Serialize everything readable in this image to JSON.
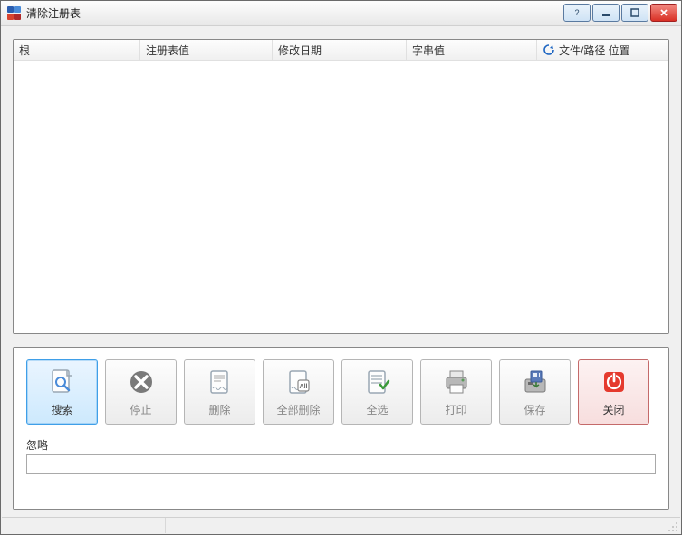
{
  "window": {
    "title": "清除注册表"
  },
  "columns": {
    "root": "根",
    "regvalue": "注册表值",
    "moddate": "修改日期",
    "strvalue": "字串值",
    "filepath": "文件/路径 位置"
  },
  "toolbar": {
    "search": "搜索",
    "stop": "停止",
    "delete": "删除",
    "delete_all": "全部删除",
    "select_all": "全选",
    "print": "打印",
    "save": "保存",
    "close": "关闭"
  },
  "ignore": {
    "label": "忽略",
    "value": ""
  }
}
